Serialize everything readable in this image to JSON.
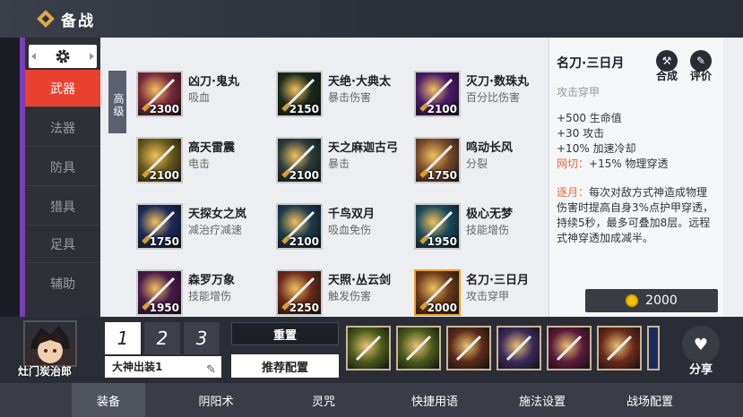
{
  "header": {
    "title": "备战"
  },
  "settings": {
    "icon": "gear-icon"
  },
  "sidebar": {
    "items": [
      {
        "label": "武器",
        "active": true
      },
      {
        "label": "法器"
      },
      {
        "label": "防具"
      },
      {
        "label": "猎具"
      },
      {
        "label": "足具"
      },
      {
        "label": "辅助"
      }
    ]
  },
  "grade_label": "高级",
  "items": [
    {
      "name": "凶刀·鬼丸",
      "effect": "吸血",
      "cost": "2300",
      "color": "#7a2a3a"
    },
    {
      "name": "天绝·大典太",
      "effect": "暴击伤害",
      "cost": "2150",
      "color": "#1a2a1a"
    },
    {
      "name": "灭刀·数珠丸",
      "effect": "百分比伤害",
      "cost": "2100",
      "color": "#4a1a6a"
    },
    {
      "name": "高天雷震",
      "effect": "电击",
      "cost": "2100",
      "color": "#6a5a1a"
    },
    {
      "name": "天之麻迦古弓",
      "effect": "暴击",
      "cost": "2100",
      "color": "#2a3a3a"
    },
    {
      "name": "鸣动长风",
      "effect": "分裂",
      "cost": "1750",
      "color": "#7a4a2a"
    },
    {
      "name": "天探女之岚",
      "effect": "减治疗减速",
      "cost": "1750",
      "color": "#1a2a5a"
    },
    {
      "name": "千鸟双月",
      "effect": "吸血免伤",
      "cost": "2100",
      "color": "#1a3a4a"
    },
    {
      "name": "极心无梦",
      "effect": "技能增伤",
      "cost": "1950",
      "color": "#1a4a5a"
    },
    {
      "name": "森罗万象",
      "effect": "技能增伤",
      "cost": "1950",
      "color": "#4a1a4a"
    },
    {
      "name": "天照·丛云剑",
      "effect": "触发伤害",
      "cost": "2250",
      "color": "#6a2a1a"
    },
    {
      "name": "名刀·三日月",
      "effect": "攻击穿甲",
      "cost": "2000",
      "color": "#6a3a1a"
    }
  ],
  "detail": {
    "name": "名刀·三日月",
    "synth_label": "合成",
    "review_label": "评价",
    "type": "攻击穿甲",
    "stats": [
      "+500 生命值",
      "+30 攻击",
      "+10% 加速冷却"
    ],
    "passive1_name": "网切：",
    "passive1_text": "+15% 物理穿透",
    "passive2_name": "逐月：",
    "passive2_text": "每次对敌方式神造成物理伤害时提高自身3%点护甲穿透，持续5秒，最多可叠加8层。远程式神穿透加成减半。",
    "price": "2000"
  },
  "loadout": {
    "player_name": "灶门炭治郎",
    "slots": [
      "1",
      "2",
      "3"
    ],
    "build_name": "大神出装1",
    "reset_label": "重置",
    "recommend_label": "推荐配置",
    "share_label": "分享",
    "equipped_colors": [
      "#4a5a1a",
      "#4a5a1a",
      "#5a2a1a",
      "#3a2a5a",
      "#5a1a3a",
      "#6a2a1a"
    ]
  },
  "nav": {
    "tabs": [
      {
        "label": "装备",
        "active": true
      },
      {
        "label": "阴阳术"
      },
      {
        "label": "灵咒"
      },
      {
        "label": "快捷用语"
      },
      {
        "label": "施法设置"
      },
      {
        "label": "战场配置"
      }
    ]
  }
}
